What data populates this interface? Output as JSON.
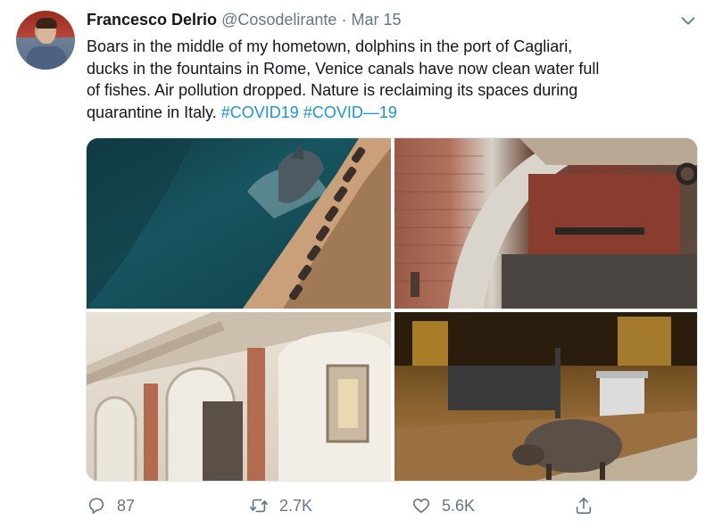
{
  "tweet": {
    "author_name": "Francesco Delrio",
    "handle": "@Cosodelirante",
    "separator": "·",
    "date": "Mar 15",
    "text_lines": [
      "Boars in the middle of my hometown, dolphins in the port of Cagliari,",
      "ducks in the fountains in Rome, Venice canals have now clean water full",
      "of fishes. Air pollution dropped. Nature is reclaiming its spaces during",
      "quarantine in Italy. "
    ],
    "hashtags": [
      "#COVID19",
      "#COVID—19"
    ]
  },
  "actions": {
    "reply_count": "87",
    "retweet_count": "2.7K",
    "like_count": "5.6K"
  },
  "icons": {
    "caret": "chevron-down-icon",
    "reply": "reply-icon",
    "retweet": "retweet-icon",
    "like": "heart-icon",
    "share": "share-icon"
  },
  "colors": {
    "link": "#1b95e0",
    "muted": "#657786",
    "text": "#14171a"
  }
}
